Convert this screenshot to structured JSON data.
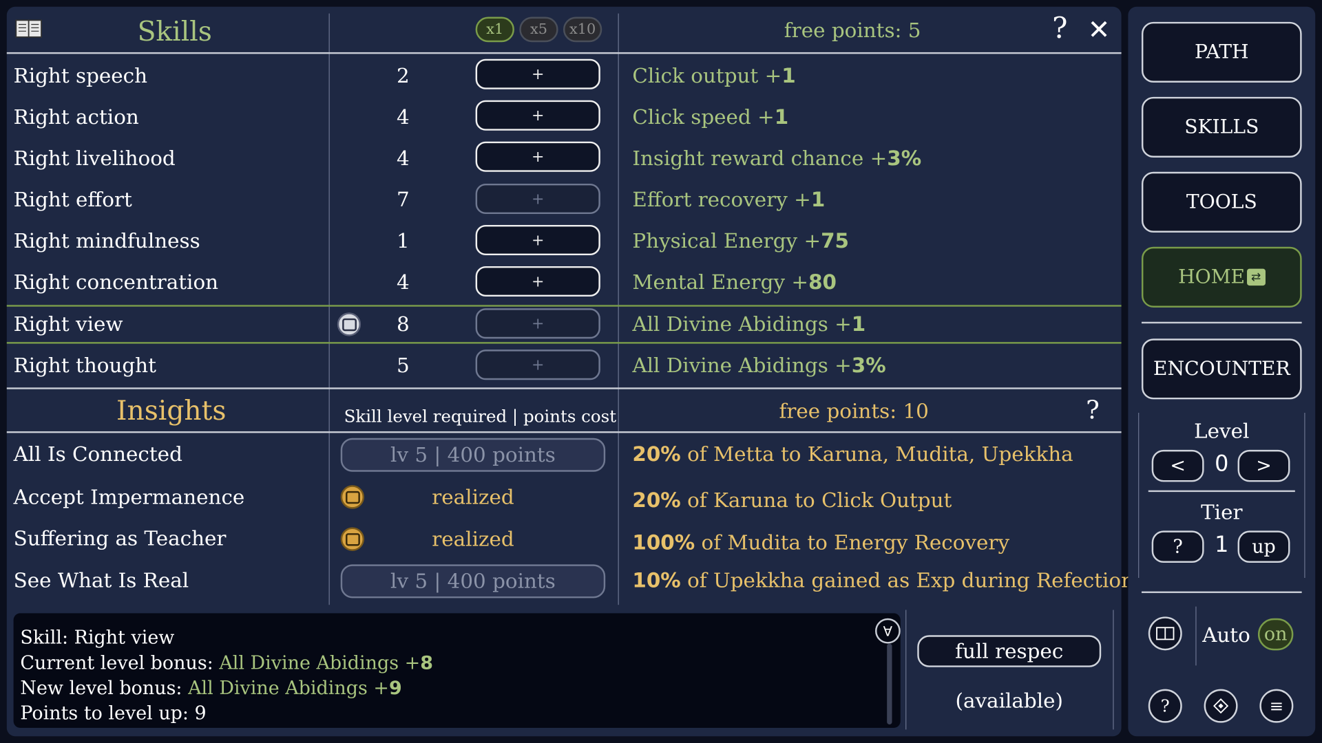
{
  "skills": {
    "title": "Skills",
    "multipliers": [
      "x1",
      "x5",
      "x10"
    ],
    "free_points": "free points: 5",
    "help": "?",
    "close": "✕",
    "plus": "+",
    "rows": [
      {
        "name": "Right speech",
        "level": "2",
        "bonus_text": "Click output +",
        "bonus_value": "1",
        "enabled": true
      },
      {
        "name": "Right action",
        "level": "4",
        "bonus_text": "Click speed +",
        "bonus_value": "1",
        "enabled": true
      },
      {
        "name": "Right livelihood",
        "level": "4",
        "bonus_text": "Insight reward chance +",
        "bonus_value": "3%",
        "enabled": true
      },
      {
        "name": "Right effort",
        "level": "7",
        "bonus_text": "Effort recovery +",
        "bonus_value": "1",
        "enabled": false
      },
      {
        "name": "Right mindfulness",
        "level": "1",
        "bonus_text": "Physical Energy +",
        "bonus_value": "75",
        "enabled": true
      },
      {
        "name": "Right concentration",
        "level": "4",
        "bonus_text": "Mental Energy +",
        "bonus_value": "80",
        "enabled": true
      },
      {
        "name": "Right view",
        "level": "8",
        "bonus_text": "All Divine Abidings +",
        "bonus_value": "1",
        "enabled": false,
        "selected": true
      },
      {
        "name": "Right thought",
        "level": "5",
        "bonus_text": "All Divine Abidings +",
        "bonus_value": "3%",
        "enabled": false
      }
    ]
  },
  "insights": {
    "title": "Insights",
    "header": "Skill level required | points cost",
    "free_points": "free points: 10",
    "help": "?",
    "rows": [
      {
        "name": "All Is Connected",
        "status": "lv 5 | 400 points",
        "realized": false,
        "effect_value": "20%",
        "effect_text": " of Metta to Karuna, Mudita, Upekkha"
      },
      {
        "name": "Accept Impermanence",
        "status": "realized",
        "realized": true,
        "effect_value": "20%",
        "effect_text": " of Karuna to Click Output"
      },
      {
        "name": "Suffering as Teacher",
        "status": "realized",
        "realized": true,
        "effect_value": "100%",
        "effect_text": " of Mudita to Energy Recovery"
      },
      {
        "name": "See What Is Real",
        "status": "lv 5 | 400 points",
        "realized": false,
        "effect_value": "10%",
        "effect_text": " of Upekkha gained as Exp during Refection"
      }
    ]
  },
  "info": {
    "skill": "Skill: Right view",
    "current_label": "Current level bonus: ",
    "current_text": "All Divine Abidings +",
    "current_value": "8",
    "new_label": "New level bonus: ",
    "new_text": "All Divine Abidings +",
    "new_value": "9",
    "points": "Points to level up: 9",
    "collapse": "∀"
  },
  "respec": {
    "button": "full respec",
    "status": "(available)"
  },
  "side": {
    "path": "PATH",
    "skills": "SKILLS",
    "tools": "TOOLS",
    "home": "HOME",
    "encounter": "ENCOUNTER",
    "level_label": "Level",
    "level_prev": "<",
    "level_value": "0",
    "level_next": ">",
    "tier_label": "Tier",
    "tier_help": "?",
    "tier_value": "1",
    "tier_up": "up",
    "auto_label": "Auto",
    "auto_state": "on",
    "help": "?",
    "menu": "≡"
  },
  "colors": {
    "panel": "#1e2843",
    "accent_green": "#a9c57f",
    "accent_gold": "#e8c16a",
    "disabled": "#6f7891"
  }
}
